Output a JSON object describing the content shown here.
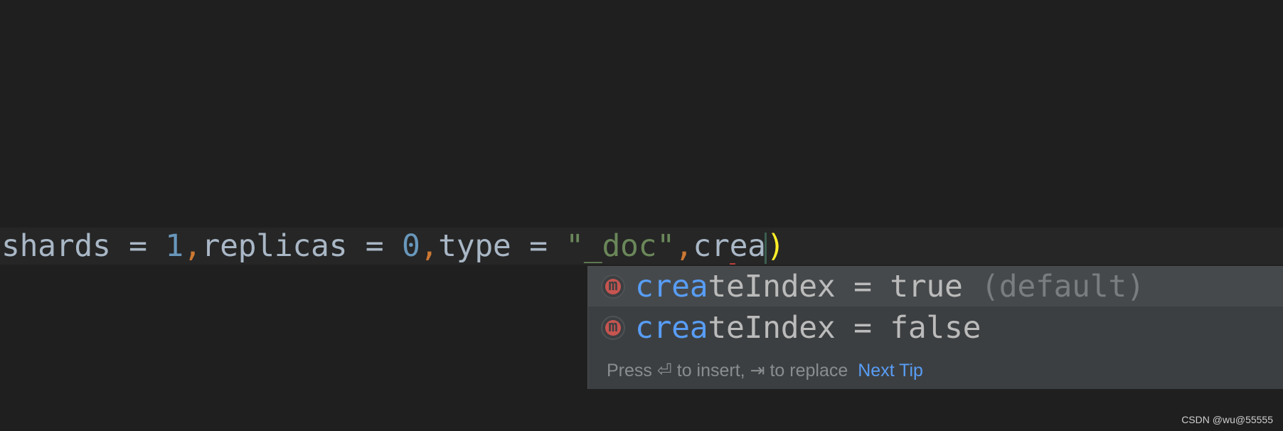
{
  "code_line": {
    "t1": "shards = ",
    "n1": "1",
    "c1": ",",
    "t2": "replicas = ",
    "n2": "0",
    "c2": ",",
    "t3": "type = ",
    "s1": "\"_doc\"",
    "c3": ",",
    "t4": "crea",
    "paren": ")"
  },
  "completion_popup": {
    "items": [
      {
        "icon": "method-icon",
        "icon_glyph": "m",
        "match": "crea",
        "rest": "teIndex = true",
        "hint": " (default)",
        "selected": true
      },
      {
        "icon": "method-icon",
        "icon_glyph": "m",
        "match": "crea",
        "rest": "teIndex = false",
        "hint": "",
        "selected": false
      }
    ],
    "footer": {
      "text": "Press ⏎ to insert, ⇥ to replace",
      "next_tip": "Next Tip"
    }
  },
  "watermark": "CSDN @wu@55555",
  "colors": {
    "background": "#1f1f1f",
    "popup_background": "#3c3f41",
    "match": "#589df6",
    "number": "#6897bb",
    "comma": "#cc7832",
    "string": "#6a8759",
    "paren_highlight": "#ffef28"
  }
}
